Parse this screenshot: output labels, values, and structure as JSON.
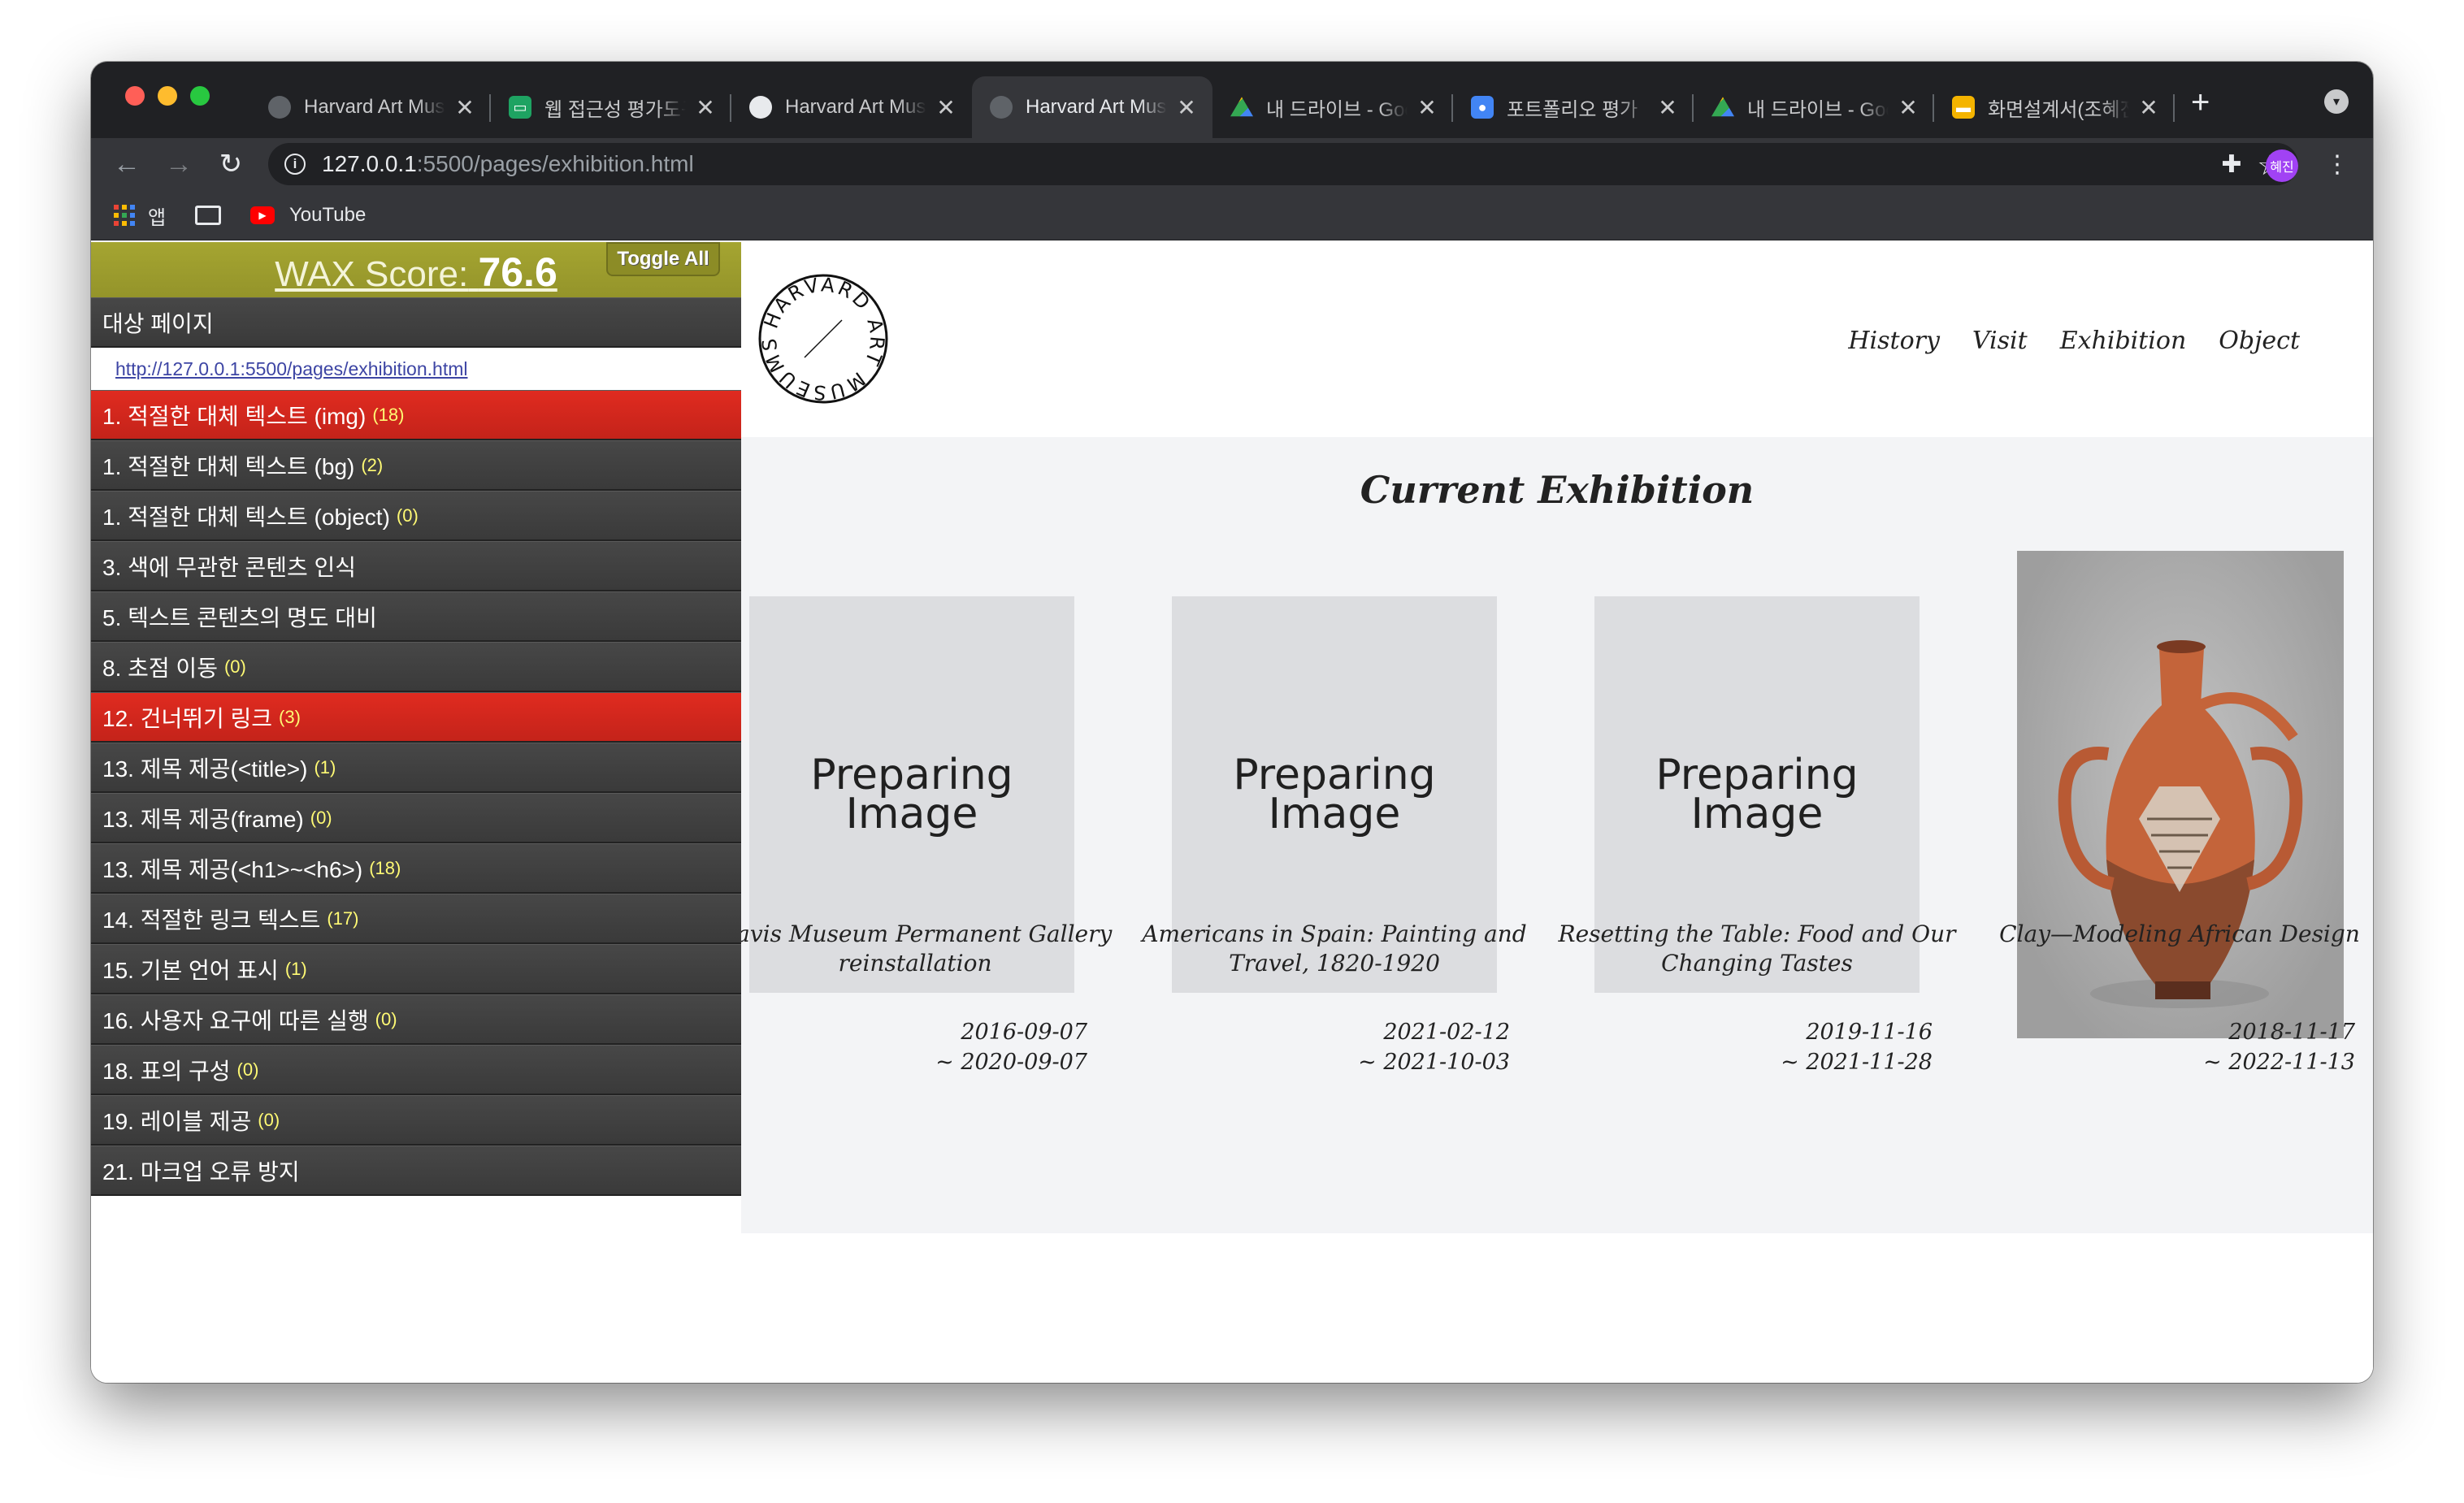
{
  "browser": {
    "tabs": [
      {
        "title": "Harvard Art Museums",
        "icon": "globe-icon"
      },
      {
        "title": "웹 접근성 평가도구",
        "icon": "chat-icon"
      },
      {
        "title": "Harvard Art Museums",
        "icon": "globe-icon"
      },
      {
        "title": "Harvard Art Museums",
        "icon": "globe-icon",
        "active": true
      },
      {
        "title": "내 드라이브 - Google Drive",
        "icon": "drive-icon"
      },
      {
        "title": "포트폴리오 평가",
        "icon": "classroom-icon"
      },
      {
        "title": "내 드라이브 - Google Drive",
        "icon": "drive-icon"
      },
      {
        "title": "화면설계서(조혜진)",
        "icon": "slides-icon"
      }
    ],
    "close_glyph": "✕",
    "new_tab_glyph": "+",
    "url_host": "127.0.0.1",
    "url_path": ":5500/pages/exhibition.html",
    "profile_label": "혜진",
    "bookmarks": {
      "apps_label": "앱",
      "youtube_label": "YouTube"
    }
  },
  "wax": {
    "score_label": "WAX Score:",
    "score_value": "76.6",
    "toggle_label": "Toggle All",
    "target_label": "대상 페이지",
    "target_url": "http://127.0.0.1:5500/pages/exhibition.html",
    "rows": [
      {
        "label": "1. 적절한 대체 텍스트 (img)",
        "count": "(18)",
        "status": "fail"
      },
      {
        "label": "1. 적절한 대체 텍스트 (bg)",
        "count": "(2)",
        "status": "neutral"
      },
      {
        "label": "1. 적절한 대체 텍스트 (object)",
        "count": "(0)",
        "status": "neutral"
      },
      {
        "label": "3. 색에 무관한 콘텐츠 인식",
        "count": "",
        "status": "neutral"
      },
      {
        "label": "5. 텍스트 콘텐츠의 명도 대비",
        "count": "",
        "status": "neutral"
      },
      {
        "label": "8. 초점 이동",
        "count": "(0)",
        "status": "neutral"
      },
      {
        "label": "12. 건너뛰기 링크",
        "count": "(3)",
        "status": "fail"
      },
      {
        "label": "13. 제목 제공(<title>)",
        "count": "(1)",
        "status": "neutral"
      },
      {
        "label": "13. 제목 제공(frame)",
        "count": "(0)",
        "status": "neutral"
      },
      {
        "label": "13. 제목 제공(<h1>~<h6>)",
        "count": "(18)",
        "status": "neutral"
      },
      {
        "label": "14. 적절한 링크 텍스트",
        "count": "(17)",
        "status": "neutral"
      },
      {
        "label": "15. 기본 언어 표시",
        "count": "(1)",
        "status": "neutral"
      },
      {
        "label": "16. 사용자 요구에 따른 실행",
        "count": "(0)",
        "status": "neutral"
      },
      {
        "label": "18. 표의 구성",
        "count": "(0)",
        "status": "neutral"
      },
      {
        "label": "19. 레이블 제공",
        "count": "(0)",
        "status": "neutral"
      },
      {
        "label": "21. 마크업 오류 방지",
        "count": "",
        "status": "neutral"
      }
    ],
    "colors": {
      "header": "#a5a531",
      "fail": "#e02b20",
      "row": "#404040",
      "count": "#fffa74"
    }
  },
  "site": {
    "logo_text": "HARVARD ART MUSEUMS",
    "nav": [
      "History",
      "Visit",
      "Exhibition",
      "Object"
    ],
    "section_title": "Current Exhibition",
    "placeholder_line1": "Preparing",
    "placeholder_line2": "Image",
    "exhibitions": [
      {
        "title": "Davis Museum Permanent Gallery reinstallation",
        "start": "2016-09-07",
        "end": "~ 2020-09-07",
        "image": "placeholder"
      },
      {
        "title": "Americans in Spain: Painting and Travel, 1820-1920",
        "start": "2021-02-12",
        "end": "~ 2021-10-03",
        "image": "placeholder"
      },
      {
        "title": "Resetting the Table: Food and Our Changing Tastes",
        "start": "2019-11-16",
        "end": "~ 2021-11-28",
        "image": "placeholder"
      },
      {
        "title": "Clay—Modeling African Design",
        "start": "2018-11-17",
        "end": "~ 2022-11-13",
        "image": "photo"
      }
    ]
  }
}
